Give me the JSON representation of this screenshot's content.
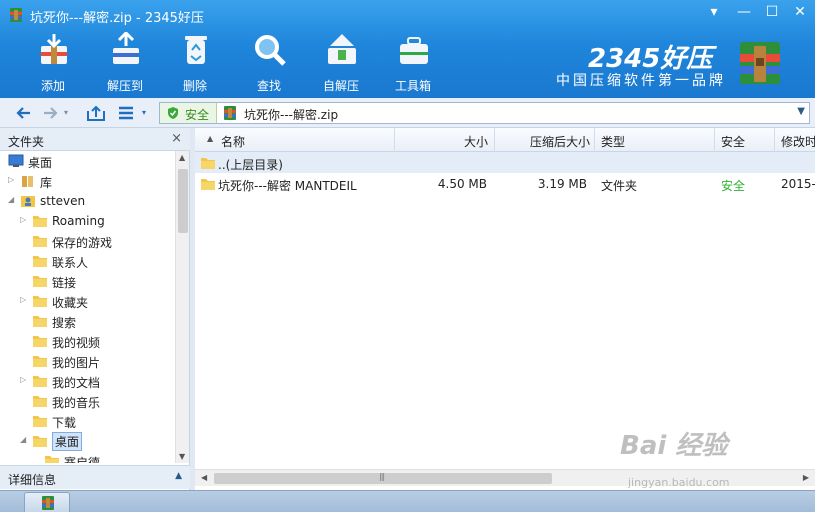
{
  "window": {
    "title": "坑死你---解密.zip - 2345好压",
    "menu_glyph": "▾",
    "min_glyph": "—",
    "max_glyph": "☐",
    "close_glyph": "✕"
  },
  "toolbar": {
    "add": "添加",
    "extract": "解压到",
    "delete": "删除",
    "find": "查找",
    "sfx": "自解压",
    "tools": "工具箱"
  },
  "brand": {
    "logo": "2345好压",
    "slogan": "中国压缩软件第一品牌"
  },
  "address": {
    "secure_label": "安全",
    "path": "坑死你---解密.zip"
  },
  "left_pane": {
    "title": "文件夹",
    "close": "×",
    "details_label": "详细信息",
    "tree": [
      {
        "label": "桌面",
        "indent": 0,
        "arrow": "",
        "icon": "desktop"
      },
      {
        "label": "库",
        "indent": 0,
        "arrow": "▷",
        "icon": "library"
      },
      {
        "label": "stteven",
        "indent": 0,
        "arrow": "◢",
        "icon": "user"
      },
      {
        "label": "Roaming",
        "indent": 1,
        "arrow": "▷",
        "icon": "folder"
      },
      {
        "label": "保存的游戏",
        "indent": 1,
        "arrow": "",
        "icon": "folder"
      },
      {
        "label": "联系人",
        "indent": 1,
        "arrow": "",
        "icon": "folder"
      },
      {
        "label": "链接",
        "indent": 1,
        "arrow": "",
        "icon": "folder"
      },
      {
        "label": "收藏夹",
        "indent": 1,
        "arrow": "▷",
        "icon": "folder"
      },
      {
        "label": "搜索",
        "indent": 1,
        "arrow": "",
        "icon": "folder"
      },
      {
        "label": "我的视频",
        "indent": 1,
        "arrow": "",
        "icon": "folder"
      },
      {
        "label": "我的图片",
        "indent": 1,
        "arrow": "",
        "icon": "folder"
      },
      {
        "label": "我的文档",
        "indent": 1,
        "arrow": "▷",
        "icon": "folder"
      },
      {
        "label": "我的音乐",
        "indent": 1,
        "arrow": "",
        "icon": "folder"
      },
      {
        "label": "下载",
        "indent": 1,
        "arrow": "",
        "icon": "folder"
      },
      {
        "label": "桌面",
        "indent": 1,
        "arrow": "◢",
        "icon": "folder",
        "selected": true
      },
      {
        "label": "赛启德",
        "indent": 2,
        "arrow": "",
        "icon": "folder"
      }
    ]
  },
  "file_list": {
    "columns": {
      "name": "名称",
      "size": "大小",
      "packed": "压缩后大小",
      "type": "类型",
      "safe": "安全",
      "modified": "修改时"
    },
    "parent_row": "..(上层目录)",
    "rows": [
      {
        "name": "坑死你---解密 MANTDEIL",
        "size": "4.50 MB",
        "packed": "3.19 MB",
        "type": "文件夹",
        "safe": "安全",
        "modified": "2015-"
      }
    ],
    "scroll_grip": "|||"
  },
  "watermark": {
    "main": "Bai 经验",
    "sub": "jingyan.baidu.com"
  }
}
